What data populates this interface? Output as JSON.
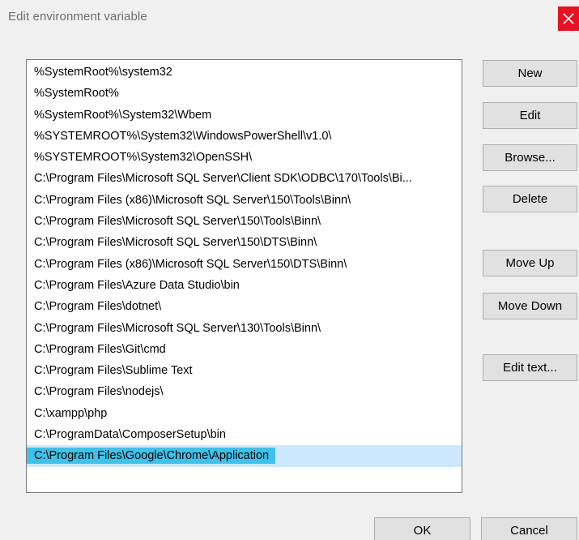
{
  "window": {
    "title": "Edit environment variable",
    "close_icon": "close-icon",
    "close_color": "#e81123"
  },
  "list": {
    "selected_index": 18,
    "selection_color": "#3fc1e8",
    "items": [
      "%SystemRoot%\\system32",
      "%SystemRoot%",
      "%SystemRoot%\\System32\\Wbem",
      "%SYSTEMROOT%\\System32\\WindowsPowerShell\\v1.0\\",
      "%SYSTEMROOT%\\System32\\OpenSSH\\",
      "C:\\Program Files\\Microsoft SQL Server\\Client SDK\\ODBC\\170\\Tools\\Bi...",
      "C:\\Program Files (x86)\\Microsoft SQL Server\\150\\Tools\\Binn\\",
      "C:\\Program Files\\Microsoft SQL Server\\150\\Tools\\Binn\\",
      "C:\\Program Files\\Microsoft SQL Server\\150\\DTS\\Binn\\",
      "C:\\Program Files (x86)\\Microsoft SQL Server\\150\\DTS\\Binn\\",
      "C:\\Program Files\\Azure Data Studio\\bin",
      "C:\\Program Files\\dotnet\\",
      "C:\\Program Files\\Microsoft SQL Server\\130\\Tools\\Binn\\",
      "C:\\Program Files\\Git\\cmd",
      "C:\\Program Files\\Sublime Text",
      "C:\\Program Files\\nodejs\\",
      "C:\\xampp\\php",
      "C:\\ProgramData\\ComposerSetup\\bin",
      "C:\\Program Files\\Google\\Chrome\\Application"
    ]
  },
  "buttons": {
    "new": "New",
    "edit": "Edit",
    "browse": "Browse...",
    "delete": "Delete",
    "move_up": "Move Up",
    "move_down": "Move Down",
    "edit_text": "Edit text...",
    "ok": "OK",
    "cancel": "Cancel"
  }
}
